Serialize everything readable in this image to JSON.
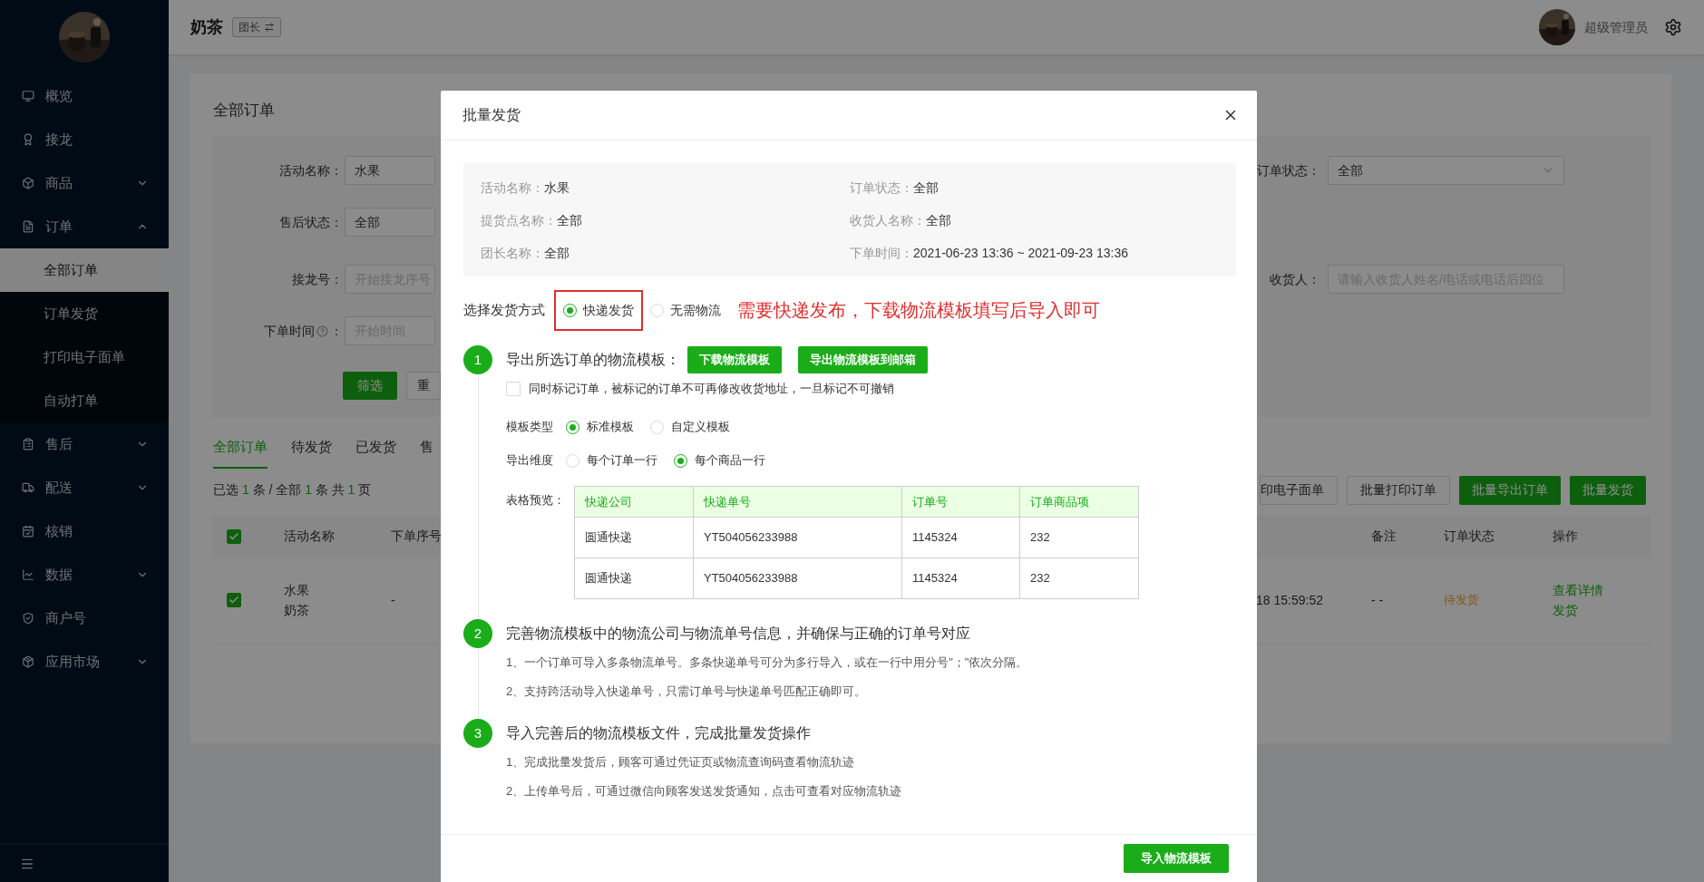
{
  "sidebar": {
    "items": [
      {
        "kind": "link",
        "label": "概览"
      },
      {
        "kind": "link",
        "label": "接龙"
      },
      {
        "kind": "group",
        "label": "商品",
        "expanded": false
      },
      {
        "kind": "group",
        "label": "订单",
        "expanded": true,
        "children": [
          {
            "label": "全部订单",
            "selected": true
          },
          {
            "label": "订单发货",
            "selected": false
          },
          {
            "label": "打印电子面单",
            "selected": false
          },
          {
            "label": "自动打单",
            "selected": false
          }
        ]
      },
      {
        "kind": "group",
        "label": "售后",
        "expanded": false
      },
      {
        "kind": "group",
        "label": "配送",
        "expanded": false
      },
      {
        "kind": "link",
        "label": "核销"
      },
      {
        "kind": "group",
        "label": "数据",
        "expanded": false
      },
      {
        "kind": "link",
        "label": "商户号"
      },
      {
        "kind": "group",
        "label": "应用市场",
        "expanded": false
      }
    ]
  },
  "header": {
    "shop": "奶茶",
    "role": "团长",
    "user": "超级管理员"
  },
  "page": {
    "title": "全部订单",
    "filters": {
      "activity": {
        "label": "活动名称：",
        "value": "水果"
      },
      "order_status": {
        "label": "订单状态：",
        "value": "全部"
      },
      "after_sale": {
        "label": "售后状态：",
        "value": "全部"
      },
      "solitaire_no": {
        "label": "接龙号：",
        "placeholder": "开始接龙序号"
      },
      "consignee": {
        "label": "收货人：",
        "placeholder": "请输入收货人姓名/电话或电话后四位"
      },
      "order_time": {
        "label": "下单时间",
        "colon": "：",
        "placeholder": "开始时间"
      }
    },
    "filter_buttons": [
      {
        "label": "筛选",
        "primary": true
      },
      {
        "label": "重",
        "primary": false
      }
    ],
    "tabs": [
      {
        "label": "全部订单",
        "selected": true
      },
      {
        "label": "待发货",
        "selected": false
      },
      {
        "label": "已发货",
        "selected": false
      },
      {
        "label": "售",
        "selected": false
      }
    ],
    "summary": [
      {
        "text": "已选 ",
        "highlight": false
      },
      {
        "text": "1",
        "highlight": true
      },
      {
        "text": " 条 / 全部 ",
        "highlight": false
      },
      {
        "text": "1",
        "highlight": true
      },
      {
        "text": " 条 共 ",
        "highlight": false
      },
      {
        "text": "1",
        "highlight": true
      },
      {
        "text": " 页",
        "highlight": false
      }
    ],
    "actions": [
      {
        "label": "印电子面单",
        "primary": false
      },
      {
        "label": "批量打印订单",
        "primary": false
      },
      {
        "label": "批量导出订单",
        "primary": true
      },
      {
        "label": "批量发货",
        "primary": true
      }
    ],
    "table": {
      "all_checked": true,
      "columns_left": [
        "活动名称",
        "下单序号"
      ],
      "columns_right": [
        "备注",
        "订单状态",
        "操作"
      ],
      "rows": [
        {
          "checked": true,
          "activity": [
            "水果",
            "奶茶"
          ],
          "serial": "-",
          "time": "18 15:59:52",
          "note": "- -",
          "status": "待发货",
          "operations": [
            "查看详情",
            "发货"
          ]
        }
      ]
    }
  },
  "dialog": {
    "title": "批量发货",
    "info": [
      {
        "label": "活动名称：",
        "value": "水果"
      },
      {
        "label": "订单状态：",
        "value": "全部"
      },
      {
        "label": "提货点名称：",
        "value": "全部"
      },
      {
        "label": "收货人名称：",
        "value": "全部"
      },
      {
        "label": "团长名称：",
        "value": "全部"
      },
      {
        "label": "下单时间：",
        "value": "2021-06-23 13:36 ~ 2021-09-23 13:36"
      }
    ],
    "method": {
      "label": "选择发货方式",
      "options": [
        {
          "label": "快递发货",
          "selected": true,
          "highlighted": true
        },
        {
          "label": "无需物流",
          "selected": false,
          "highlighted": false
        }
      ],
      "note": "需要快递发布，下载物流模板填写后导入即可"
    },
    "step1": {
      "number": "1",
      "title": "导出所选订单的物流模板：",
      "buttons": [
        "下载物流模板",
        "导出物流模板到邮箱"
      ],
      "mark_orders": {
        "label": "同时标记订单，被标记的订单不可再修改收货地址，一旦标记不可撤销",
        "checked": false
      },
      "option_groups": [
        {
          "label": "模板类型",
          "options": [
            {
              "label": "标准模板",
              "selected": true
            },
            {
              "label": "自定义模板",
              "selected": false
            }
          ]
        },
        {
          "label": "导出维度",
          "options": [
            {
              "label": "每个订单一行",
              "selected": false
            },
            {
              "label": "每个商品一行",
              "selected": true
            }
          ]
        }
      ],
      "preview": {
        "label": "表格预览：",
        "columns": [
          "快递公司",
          "快递单号",
          "订单号",
          "订单商品项"
        ],
        "rows": [
          [
            "圆通快递",
            "YT504056233988",
            "1145324",
            "232"
          ],
          [
            "圆通快递",
            "YT504056233988",
            "1145324",
            "232"
          ]
        ]
      }
    },
    "steps": [
      {
        "number": "2",
        "title": "完善物流模板中的物流公司与物流单号信息，并确保与正确的订单号对应",
        "notes": [
          "1、一个订单可导入多条物流单号。多条快递单号可分为多行导入，或在一行中用分号\"；\"依次分隔。",
          "2、支持跨活动导入快递单号，只需订单号与快递单号匹配正确即可。"
        ]
      },
      {
        "number": "3",
        "title": "导入完善后的物流模板文件，完成批量发货操作",
        "notes": [
          "1、完成批量发货后，顾客可通过凭证页或物流查询码查看物流轨迹",
          "2、上传单号后，可通过微信向顾客发送发货通知，点击可查看对应物流轨迹"
        ]
      }
    ],
    "footer_button": "导入物流模板"
  }
}
